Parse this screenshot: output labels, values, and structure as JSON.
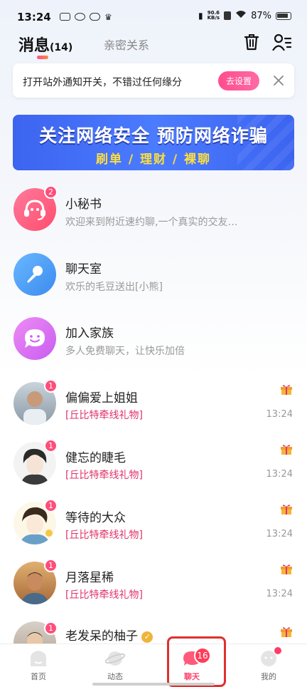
{
  "status_bar": {
    "time": "13:24",
    "network_speed_value": "90.6",
    "network_speed_unit": "KB/s",
    "battery": "87%"
  },
  "header": {
    "tab_messages": "消息",
    "message_count": "(14)",
    "tab_intimate": "亲密关系",
    "delete_icon": "trash-icon",
    "contacts_icon": "contacts-icon"
  },
  "notification": {
    "text": "打开站外通知开关，不错过任何缘分",
    "button": "去设置"
  },
  "safety_banner": {
    "title": "关注网络安全 预防网络诈骗",
    "subtitle": "刷单 / 理财 / 裸聊"
  },
  "list": [
    {
      "name": "小秘书",
      "preview": "欢迎来到附近速约聊,一个真实的交友…",
      "badge": "2",
      "icon": "headset-icon"
    },
    {
      "name": "聊天室",
      "preview": "欢乐的毛豆送出[小熊]",
      "badge": "",
      "icon": "microphone-icon"
    },
    {
      "name": "加入家族",
      "preview": "多人免费聊天，让快乐加倍",
      "badge": "",
      "icon": "smiley-chat-icon"
    },
    {
      "name": "偏偏爱上姐姐",
      "preview": "[丘比特牵线礼物]",
      "badge": "1",
      "time": "13:24"
    },
    {
      "name": "健忘的睫毛",
      "preview": "[丘比特牵线礼物]",
      "badge": "1",
      "time": "13:24"
    },
    {
      "name": "等待的大众",
      "preview": "[丘比特牵线礼物]",
      "badge": "1",
      "time": "13:24"
    },
    {
      "name": "月落星稀",
      "preview": "[丘比特牵线礼物]",
      "badge": "1",
      "time": "13:24"
    },
    {
      "name": "老发呆的柚子",
      "preview": "",
      "badge": "1",
      "time": ""
    }
  ],
  "bottom_nav": {
    "items": [
      {
        "label": "首页",
        "icon": "home-icon"
      },
      {
        "label": "动态",
        "icon": "planet-icon"
      },
      {
        "label": "聊天",
        "icon": "chat-icon",
        "count": "16"
      },
      {
        "label": "我的",
        "icon": "profile-icon"
      }
    ]
  },
  "colors": {
    "accent_pink": "#ff4d7a",
    "gift_red": "#e0336a",
    "banner_blue": "#4b7bff",
    "banner_yellow": "#ffdf3b"
  }
}
